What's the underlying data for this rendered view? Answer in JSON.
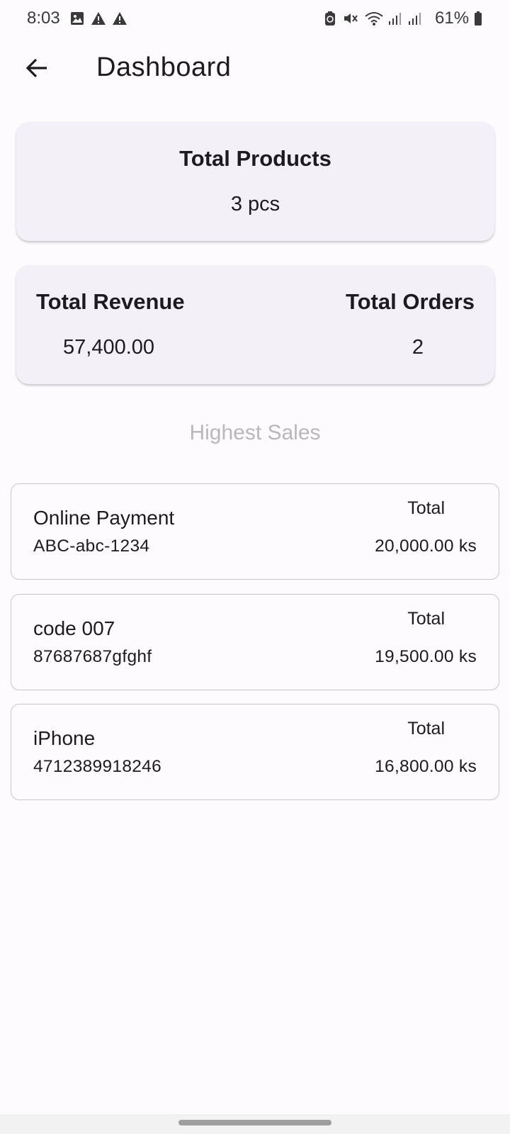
{
  "status_bar": {
    "time": "8:03",
    "battery_percent": "61%",
    "icons": [
      "image-notification-icon",
      "warning-icon",
      "warning-icon",
      "battery-saver-icon",
      "mute-icon",
      "wifi-icon",
      "signal-icon",
      "signal-icon",
      "battery-icon"
    ]
  },
  "app_bar": {
    "title": "Dashboard",
    "back_icon": "arrow-back-icon"
  },
  "summary": {
    "products_label": "Total Products",
    "products_value": "3 pcs",
    "revenue_label": "Total Revenue",
    "revenue_value": "57,400.00",
    "orders_label": "Total Orders",
    "orders_value": "2"
  },
  "highest_sales": {
    "title": "Highest Sales",
    "items": [
      {
        "name": "Online Payment",
        "code": "ABC-abc-1234",
        "total_label": "Total",
        "amount": "20,000.00 ks"
      },
      {
        "name": "code 007",
        "code": "87687687gfghf",
        "total_label": "Total",
        "amount": "19,500.00 ks"
      },
      {
        "name": "iPhone",
        "code": "4712389918246",
        "total_label": "Total",
        "amount": "16,800.00 ks"
      }
    ]
  },
  "colors": {
    "background": "#fdfbfe",
    "card": "#f3f1f7",
    "text": "#1d1b20",
    "muted_text": "#b9b7bc",
    "border": "#c9c6cd"
  }
}
